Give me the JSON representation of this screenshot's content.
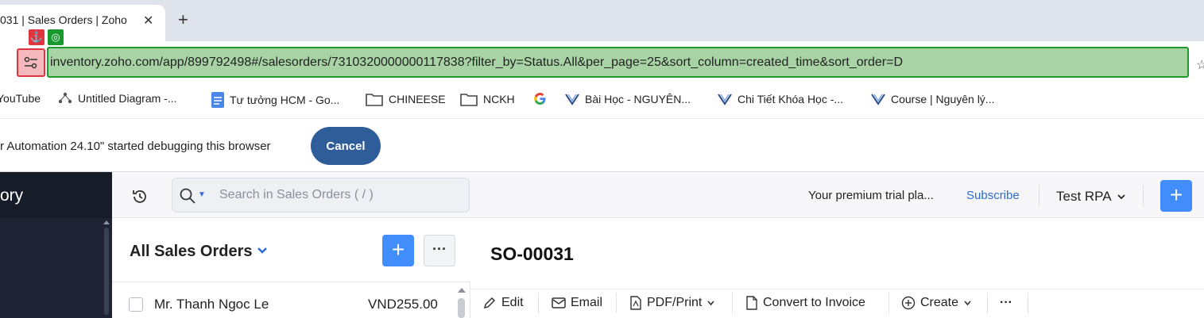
{
  "browser": {
    "tab_title": "031 | Sales Orders | Zoho",
    "new_tab_symbol": "+",
    "url": "inventory.zoho.com/app/899792498#/salesorders/7310320000000117838?filter_by=Status.All&per_page=25&sort_column=created_time&sort_order=D",
    "badges": {
      "anchor": "⚓",
      "target": "◎"
    }
  },
  "bookmarks": [
    {
      "label": "YouTube",
      "icon": "youtube-icon"
    },
    {
      "label": "Untitled Diagram -...",
      "icon": "diagram-icon"
    },
    {
      "label": "Tư tưởng HCM - Go...",
      "icon": "docs-icon"
    },
    {
      "label": "CHINEESE",
      "icon": "folder-icon"
    },
    {
      "label": "NCKH",
      "icon": "folder-icon"
    },
    {
      "label": "",
      "icon": "google-icon"
    },
    {
      "label": "Bài Học - NGUYÊN...",
      "icon": "course-icon"
    },
    {
      "label": "Chi Tiết Khóa Học -...",
      "icon": "course-icon"
    },
    {
      "label": "Course | Nguyên lý...",
      "icon": "course-icon"
    }
  ],
  "debug_bar": {
    "message": "r Automation 24.10\" started debugging this browser",
    "cancel_label": "Cancel"
  },
  "app": {
    "sidebar_brand": "ory",
    "search_placeholder": "Search in Sales Orders ( / )",
    "trial_text": "Your premium trial pla...",
    "subscribe_label": "Subscribe",
    "org_name": "Test RPA",
    "list": {
      "title": "All Sales Orders",
      "rows": [
        {
          "name": "Mr. Thanh Ngoc Le",
          "amount": "VND255.00"
        }
      ]
    },
    "detail": {
      "title": "SO-00031",
      "toolbar": {
        "edit": "Edit",
        "email": "Email",
        "pdf_print": "PDF/Print",
        "convert": "Convert to Invoice",
        "create": "Create",
        "more": "···"
      }
    }
  },
  "colors": {
    "accent": "#408dfb",
    "cancel_button": "#2f5d99",
    "sidebar": "#1e2433",
    "url_highlight": "#a8d4a5"
  }
}
